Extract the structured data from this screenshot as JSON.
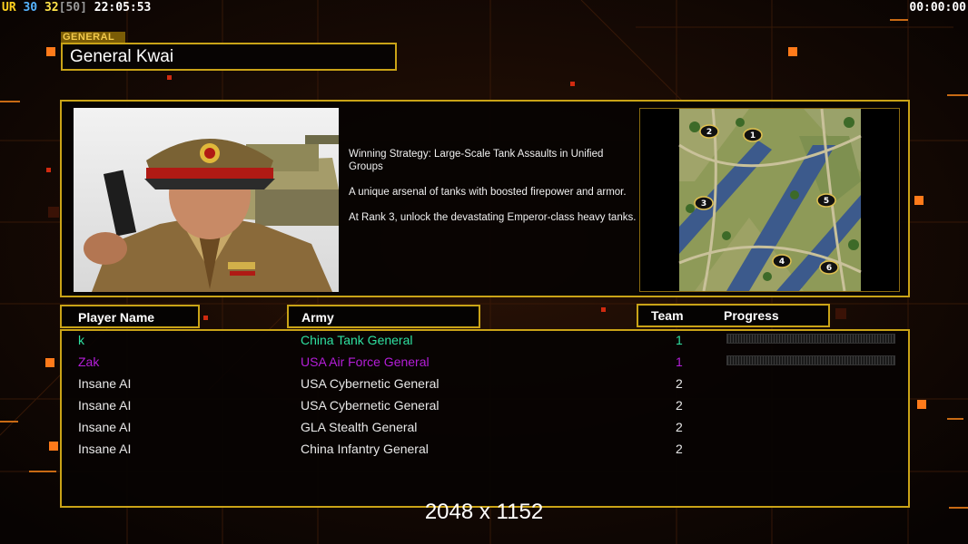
{
  "hud": {
    "ur": "UR",
    "a": "30",
    "b": "32",
    "c": "[50]",
    "clock": "22:05:53",
    "timer": "00:00:00"
  },
  "general": {
    "tag": "GENERAL",
    "name": "General Kwai"
  },
  "description": [
    "Winning Strategy: Large-Scale Tank Assaults in Unified Groups",
    "A unique arsenal of tanks with boosted firepower and armor.",
    "At Rank 3, unlock the devastating Emperor-class heavy tanks."
  ],
  "map_markers": [
    "1",
    "2",
    "3",
    "4",
    "5",
    "6"
  ],
  "columns": {
    "player": "Player Name",
    "army": "Army",
    "team": "Team",
    "progress": "Progress"
  },
  "players": [
    {
      "name": "k",
      "army": "China Tank General",
      "team": "1",
      "color": "#2fe0a0",
      "progress": 0
    },
    {
      "name": "Zak",
      "army": "USA Air Force General",
      "team": "1",
      "color": "#b41ed8",
      "progress": 0
    },
    {
      "name": "Insane AI",
      "army": "USA Cybernetic General",
      "team": "2",
      "color": "#ffffff"
    },
    {
      "name": "Insane AI",
      "army": "USA Cybernetic General",
      "team": "2",
      "color": "#ffffff"
    },
    {
      "name": "Insane AI",
      "army": "GLA Stealth General",
      "team": "2",
      "color": "#ffffff"
    },
    {
      "name": "Insane AI",
      "army": "China Infantry General",
      "team": "2",
      "color": "#ffffff"
    }
  ],
  "resolution": "2048 x 1152",
  "colors": {
    "frame": "#c9a317",
    "accent_orange": "#ff7a1a"
  }
}
